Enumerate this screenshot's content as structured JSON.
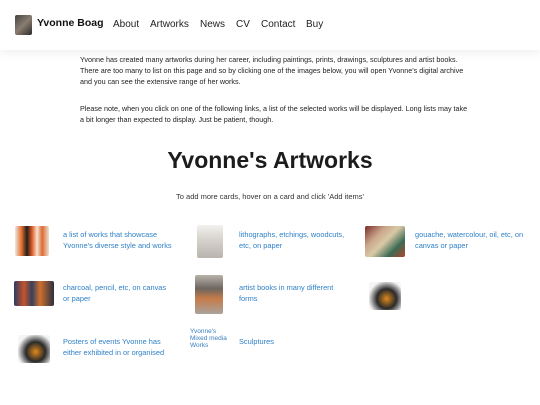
{
  "header": {
    "brand": "Yvonne Boag",
    "nav": [
      "About",
      "Artworks",
      "News",
      "CV",
      "Contact",
      "Buy"
    ]
  },
  "intro": {
    "p1": "Yvonne has created many artworks during her career, including paintings, prints, drawings, sculptures and artist books. There are too many to list on this page and so by clicking one of the images below, you will open Yvonne's digital archive and you can see the extensive range of her works.",
    "p2": "Please note, when you click on one of the following links, a list of the selected works will be displayed. Long lists may take a bit longer than expected to display. Just be patient, though."
  },
  "title": "Yvonne's Artworks",
  "subtitle": "To add more cards, hover on a card and click 'Add items'",
  "cards": [
    {
      "text": "a list of works that showcase Yvonne's diverse style and works"
    },
    {
      "text": "lithographs, etchings, woodcuts, etc, on paper"
    },
    {
      "text": "gouache, watercolour, oil, etc, on canvas or paper"
    },
    {
      "text": "charcoal, pencil, etc, on canvas or paper"
    },
    {
      "text": "artist books in many different forms"
    },
    {
      "text": ""
    },
    {
      "text": "Posters of events Yvonne has either exhibited in or organised"
    },
    {
      "text": "Sculptures",
      "alt": "Yvonne's Mixed media Works"
    }
  ]
}
